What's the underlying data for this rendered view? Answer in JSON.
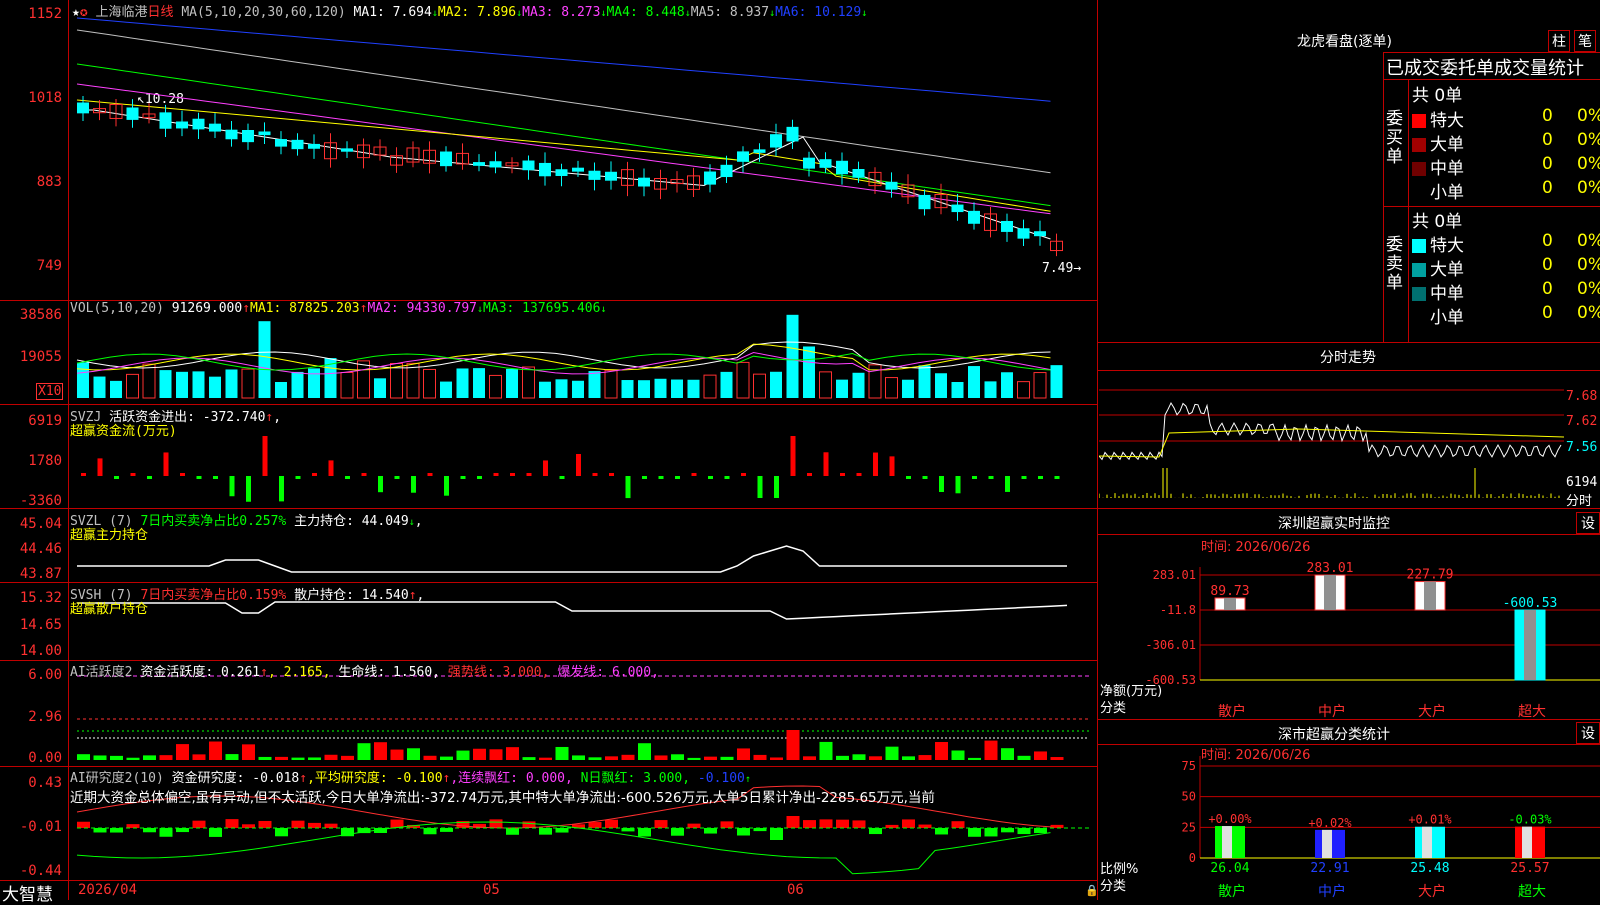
{
  "stock": {
    "name": "上海临港",
    "period": "日线"
  },
  "kline": {
    "ma_label": "MA(5,10,20,30,60,120)",
    "ma1": "MA1: 7.694",
    "ma2": "MA2: 7.896",
    "ma3": "MA3: 8.273",
    "ma4": "MA4: 8.448",
    "ma5": "MA5: 8.937",
    "ma6": "MA6: 10.129",
    "y_labels": [
      "1152",
      "1018",
      "883",
      "749"
    ],
    "high_label": "10.28",
    "last_label": "7.49",
    "colors": {
      "ma1": "#ffffff",
      "ma2": "#ffff00",
      "ma3": "#ff40ff",
      "ma4": "#00ff00",
      "ma5": "#c0c0c0",
      "ma6": "#2040ff"
    }
  },
  "vol": {
    "label": "VOL(5,10,20)",
    "value": "91269.000",
    "ma1": "MA1: 87825.203",
    "ma2": "MA2: 94330.797",
    "ma3": "MA3: 137695.406",
    "y_labels": [
      "38586",
      "19055"
    ],
    "unit": "X10"
  },
  "svzj": {
    "label": "SVZJ",
    "desc": "活跃资金进出: -372.740",
    "sub": "超赢资金流(万元)",
    "y_labels": [
      "6919",
      "1780",
      "-3360"
    ]
  },
  "svzl": {
    "label": "SVZL (7)",
    "desc": "7日内买卖净占比0.257%",
    "desc2": "主力持仓: 44.049",
    "sub": "超赢主力持仓",
    "y_labels": [
      "45.04",
      "44.46",
      "43.87"
    ]
  },
  "svsh": {
    "label": "SVSH (7)",
    "desc": "7日内买卖净占比0.159%",
    "desc2": "散户持仓: 14.540",
    "sub": "超赢散户持仓",
    "y_labels": [
      "15.32",
      "14.65",
      "14.00"
    ]
  },
  "ai_act": {
    "label": "AI活跃度2",
    "t1": "资金活跃度: 0.261",
    "t2": ", 2.165,",
    "t3": "生命线: 1.560,",
    "t4": "强势线: 3.000,",
    "t5": "爆发线: 6.000,",
    "y_labels": [
      "6.00",
      "2.96",
      "0.00"
    ]
  },
  "ai_res": {
    "label": "AI研究度2(10)",
    "t1": "资金研究度: -0.018",
    "t2": ",平均研究度: -0.100",
    "t3": ",连续飘红: 0.000,",
    "t4": "N日飘红: 3.000,",
    "t5": "-0.100",
    "comment": "近期大资金总体偏空,虽有异动,但不太活跃,今日大单净流出:-372.74万元,其中特大单净流出:-600.526万元,大单5日累计净出-2285.65万元,当前",
    "y_labels": [
      "0.43",
      "-0.01",
      "-0.44"
    ]
  },
  "bottom": {
    "brand": "大智慧",
    "date_start": "2026/04",
    "m05": "05",
    "m06": "06"
  },
  "dragon": {
    "title": "龙虎看盘(逐单)",
    "btn1": "柱",
    "btn2": "笔",
    "header": "已成交委托单成交量统计",
    "buy": {
      "side": "委买单",
      "total": "共 0单",
      "rows": [
        {
          "label": "特大",
          "v": "0",
          "p": "0%"
        },
        {
          "label": "大单",
          "v": "0",
          "p": "0%"
        },
        {
          "label": "中单",
          "v": "0",
          "p": "0%"
        },
        {
          "label": "小单",
          "v": "0",
          "p": "0%"
        }
      ]
    },
    "sell": {
      "side": "委卖单",
      "total": "共 0单",
      "rows": [
        {
          "label": "特大",
          "v": "0",
          "p": "0%"
        },
        {
          "label": "大单",
          "v": "0",
          "p": "0%"
        },
        {
          "label": "中单",
          "v": "0",
          "p": "0%"
        },
        {
          "label": "小单",
          "v": "0",
          "p": "0%"
        }
      ]
    }
  },
  "intraday": {
    "title": "分时走势",
    "y_labels": [
      "7.68",
      "7.62",
      "7.56"
    ],
    "vol_label": "6194",
    "foot": "分时"
  },
  "monitor": {
    "title": "深圳超赢实时监控",
    "btn": "设",
    "time": "时间: 2026/06/26",
    "y_labels": [
      "283.01",
      "-11.8",
      "-306.01",
      "-600.53"
    ],
    "ylabel": "净额(万元)",
    "xlabel": "分类",
    "bars": [
      {
        "name": "散户",
        "value": 89.73,
        "label": "89.73"
      },
      {
        "name": "中户",
        "value": 283.01,
        "label": "283.01"
      },
      {
        "name": "大户",
        "value": 227.79,
        "label": "227.79"
      },
      {
        "name": "超大",
        "value": -600.53,
        "label": "-600.53"
      }
    ]
  },
  "classify": {
    "title": "深市超赢分类统计",
    "btn": "设",
    "time": "时间: 2026/06/26",
    "y_labels": [
      "75",
      "50",
      "25",
      "0"
    ],
    "ylabel": "比例%",
    "xlabel": "分类",
    "bars": [
      {
        "name": "散户",
        "value": 26.04,
        "label": "26.04",
        "change": "+0.00%"
      },
      {
        "name": "中户",
        "value": 22.91,
        "label": "22.91",
        "change": "+0.02%"
      },
      {
        "name": "大户",
        "value": 25.48,
        "label": "25.48",
        "change": "+0.01%"
      },
      {
        "name": "超大",
        "value": 25.57,
        "label": "25.57",
        "change": "-0.03%"
      }
    ]
  },
  "chart_data": [
    {
      "type": "bar",
      "title": "深圳超赢实时监控",
      "xlabel": "分类",
      "ylabel": "净额(万元)",
      "categories": [
        "散户",
        "中户",
        "大户",
        "超大"
      ],
      "values": [
        89.73,
        283.01,
        227.79,
        -600.53
      ],
      "ylim": [
        -600.53,
        283.01
      ]
    },
    {
      "type": "bar",
      "title": "深市超赢分类统计",
      "xlabel": "分类",
      "ylabel": "比例%",
      "categories": [
        "散户",
        "中户",
        "大户",
        "超大"
      ],
      "values": [
        26.04,
        22.91,
        25.48,
        25.57
      ],
      "ylim": [
        0,
        75
      ]
    }
  ]
}
